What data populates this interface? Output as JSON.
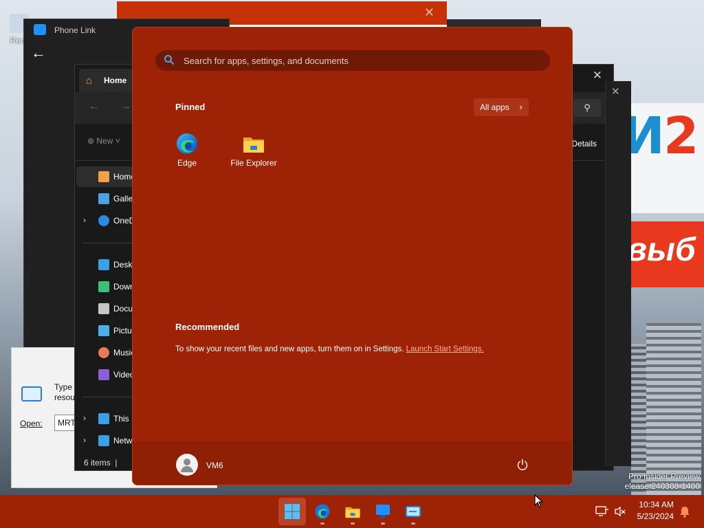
{
  "desktop": {
    "recycle_bin_label": "Recy",
    "billboard_big": "И",
    "billboard_big_red": "2",
    "billboard_red_text": "выб",
    "watermark_line1": "Pro Insider Preview",
    "watermark_line2": "elease.240308-1400"
  },
  "windows": {
    "phone_link_title": "Phone Link",
    "explorer": {
      "tab_label": "Home",
      "new_button": "New",
      "details_button": "Details",
      "sidebar": [
        {
          "label": "Home",
          "icon": "home-icon",
          "color": "#f0a04b"
        },
        {
          "label": "Gallery",
          "icon": "gallery-icon",
          "color": "#4aa3df"
        },
        {
          "label": "OneDrive",
          "icon": "onedrive-icon",
          "color": "#2a8be0"
        },
        {
          "label": "Desktop",
          "icon": "desktop-icon",
          "color": "#3aa0e8"
        },
        {
          "label": "Downloads",
          "icon": "downloads-icon",
          "color": "#3dbf7c"
        },
        {
          "label": "Documents",
          "icon": "documents-icon",
          "color": "#c6c6c6"
        },
        {
          "label": "Pictures",
          "icon": "pictures-icon",
          "color": "#4ab0e8"
        },
        {
          "label": "Music",
          "icon": "music-icon",
          "color": "#e67a5a"
        },
        {
          "label": "Videos",
          "icon": "videos-icon",
          "color": "#8a5fd8"
        },
        {
          "label": "This PC",
          "icon": "this-pc-icon",
          "color": "#3aa0e8"
        },
        {
          "label": "Network",
          "icon": "network-icon",
          "color": "#3aa0e8"
        }
      ],
      "status_text": "6 items"
    },
    "run_dialog": {
      "type_text_1": "Type",
      "type_text_2": "resou",
      "open_label": "Open:",
      "open_value": "MRT"
    }
  },
  "start_menu": {
    "search_placeholder": "Search for apps, settings, and documents",
    "pinned_title": "Pinned",
    "all_apps_label": "All apps",
    "pinned_apps": [
      {
        "label": "Edge",
        "icon": "edge-icon"
      },
      {
        "label": "File Explorer",
        "icon": "file-explorer-icon"
      }
    ],
    "recommended_title": "Recommended",
    "recommended_text": "To show your recent files and new apps, turn them on in Settings.",
    "recommended_link": "Launch Start Settings.",
    "user_name": "VM6"
  },
  "taskbar": {
    "apps": [
      {
        "name": "start",
        "icon": "windows-icon",
        "active": true
      },
      {
        "name": "edge",
        "icon": "edge-icon",
        "active": false
      },
      {
        "name": "file-explorer",
        "icon": "folder-icon",
        "active": false
      },
      {
        "name": "phone-link",
        "icon": "phone-link-icon",
        "active": false
      },
      {
        "name": "run",
        "icon": "run-icon",
        "active": false
      }
    ],
    "time": "10:34 AM",
    "date": "5/23/2024"
  },
  "colors": {
    "accent": "#9e2306",
    "start_bg": "#9e2306",
    "search_bg": "#6e1a07",
    "link": "#ffb299"
  }
}
